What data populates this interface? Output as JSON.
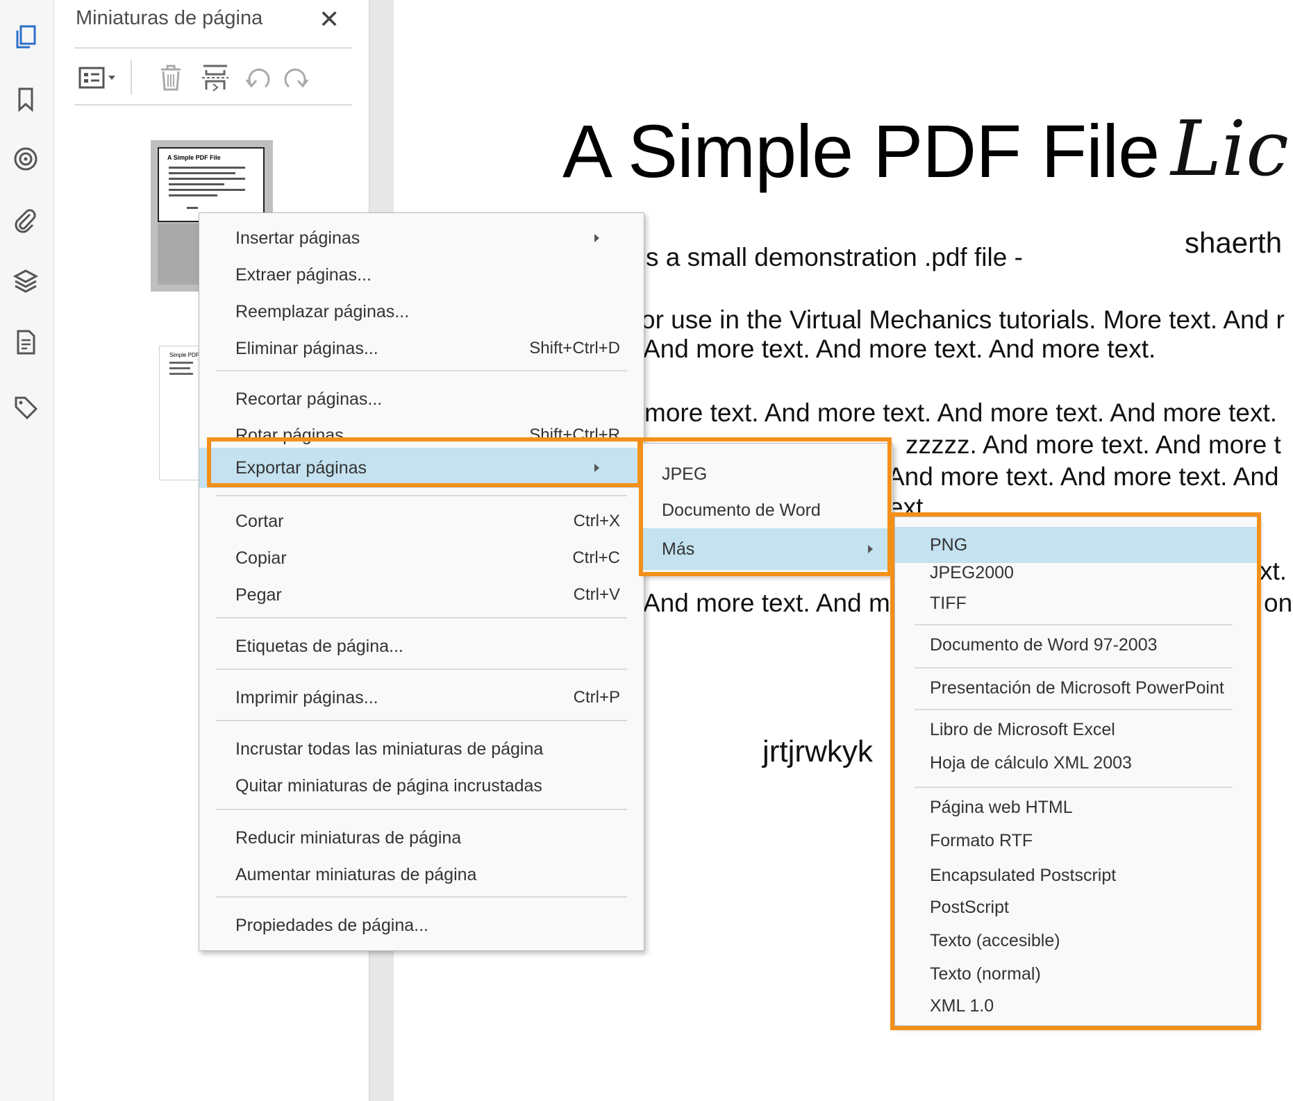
{
  "panel": {
    "title": "Miniaturas de página",
    "close": "✕",
    "thumb1_title": "A Simple PDF File",
    "thumb2_title": "Simple PDF"
  },
  "rail": {
    "icons": [
      "pages-icon",
      "bookmark-icon",
      "target-icon",
      "paperclip-icon",
      "layers-icon",
      "document-icon",
      "tag-icon"
    ]
  },
  "document": {
    "title": "A Simple PDF File",
    "signature": "Lic",
    "author": "shaerth",
    "lines": [
      "s a small demonstration .pdf file -",
      "or use in the Virtual Mechanics tutorials. More text. And r",
      "And more text. And more text. And more text.",
      "more text. And more text. And more text. And more text.",
      "zzzzz. And more text. And more t",
      "And more text. And more text. And",
      "ext.",
      "xt.",
      "And more text. And m",
      "on"
    ],
    "signature2": "jrtjrwkyk"
  },
  "context_menu": {
    "groups": [
      [
        {
          "label": "Insertar páginas",
          "submenu": true
        },
        {
          "label": "Extraer páginas..."
        },
        {
          "label": "Reemplazar páginas..."
        },
        {
          "label": "Eliminar páginas...",
          "shortcut": "Shift+Ctrl+D"
        }
      ],
      [
        {
          "label": "Recortar páginas..."
        },
        {
          "label": "Rotar páginas...",
          "shortcut": "Shift+Ctrl+R"
        },
        {
          "label": "Exportar páginas",
          "submenu": true,
          "highlighted": true
        }
      ],
      [
        {
          "label": "Cortar",
          "shortcut": "Ctrl+X"
        },
        {
          "label": "Copiar",
          "shortcut": "Ctrl+C"
        },
        {
          "label": "Pegar",
          "shortcut": "Ctrl+V"
        }
      ],
      [
        {
          "label": "Etiquetas de página..."
        }
      ],
      [
        {
          "label": "Imprimir páginas...",
          "shortcut": "Ctrl+P"
        }
      ],
      [
        {
          "label": "Incrustar todas las miniaturas de página"
        },
        {
          "label": "Quitar miniaturas de página incrustadas"
        }
      ],
      [
        {
          "label": "Reducir miniaturas de página"
        },
        {
          "label": "Aumentar miniaturas de página"
        }
      ],
      [
        {
          "label": "Propiedades de página..."
        }
      ]
    ]
  },
  "export_submenu": {
    "items": [
      {
        "label": "JPEG"
      },
      {
        "label": "Documento de Word"
      },
      {
        "label": "Más",
        "submenu": true,
        "highlighted": true
      }
    ]
  },
  "more_submenu": {
    "items": [
      {
        "label": "PNG",
        "highlighted": true
      },
      {
        "label": "JPEG2000"
      },
      {
        "label": "TIFF"
      },
      {
        "label": "Documento de Word 97-2003"
      },
      {
        "label": "Presentación de Microsoft PowerPoint"
      },
      {
        "label": "Libro de Microsoft Excel"
      },
      {
        "label": "Hoja de cálculo XML 2003"
      },
      {
        "label": "Página web HTML"
      },
      {
        "label": "Formato RTF"
      },
      {
        "label": "Encapsulated Postscript"
      },
      {
        "label": "PostScript"
      },
      {
        "label": "Texto (accesible)"
      },
      {
        "label": "Texto (normal)"
      },
      {
        "label": "XML 1.0"
      }
    ]
  },
  "colors": {
    "highlight_box": "#f39019",
    "menu_highlight": "#c4e2f0",
    "icon_blue": "#2a6fc9"
  }
}
